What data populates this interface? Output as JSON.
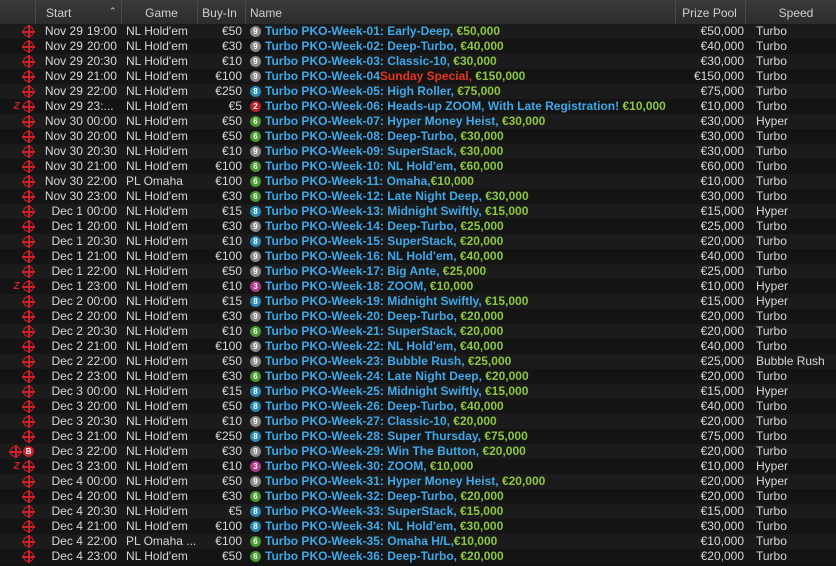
{
  "colors": {
    "badge_9": "#8a8a8a",
    "badge_6": "#4a9a32",
    "badge_8": "#2a8ab8",
    "badge_2": "#c0202a",
    "badge_3": "#b23a8a"
  },
  "icons": {
    "target": "crosshair-target-icon",
    "zoom": "zoom-z-icon",
    "bounty": "bounty-b-icon"
  },
  "columns": {
    "start": "Start",
    "game": "Game",
    "buyin": "Buy-In",
    "name": "Name",
    "prize_pool": "Prize Pool",
    "speed": "Speed"
  },
  "rows": [
    {
      "icons": [
        "target"
      ],
      "date": "Nov 29",
      "time": "19:00",
      "game": "NL Hold'em",
      "buyin": "€50",
      "badge": "9",
      "name": "Turbo PKO-Week-01: Early-Deep,",
      "special": "",
      "gtd": " €50,000",
      "pool": "€50,000",
      "speed": "Turbo"
    },
    {
      "icons": [
        "target"
      ],
      "date": "Nov 29",
      "time": "20:00",
      "game": "NL Hold'em",
      "buyin": "€30",
      "badge": "9",
      "name": "Turbo PKO-Week-02: Deep-Turbo,",
      "special": "",
      "gtd": " €40,000",
      "pool": "€40,000",
      "speed": "Turbo"
    },
    {
      "icons": [
        "target"
      ],
      "date": "Nov 29",
      "time": "20:30",
      "game": "NL Hold'em",
      "buyin": "€10",
      "badge": "9",
      "name": "Turbo PKO-Week-03: Classic-10,",
      "special": "",
      "gtd": " €30,000",
      "pool": "€30,000",
      "speed": "Turbo"
    },
    {
      "icons": [
        "target"
      ],
      "date": "Nov 29",
      "time": "21:00",
      "game": "NL Hold'em",
      "buyin": "€100",
      "badge": "9",
      "name": "Turbo PKO-Week-04 ",
      "special": "Sunday Special,",
      "gtd": " €150,000",
      "pool": "€150,000",
      "speed": "Turbo"
    },
    {
      "icons": [
        "target"
      ],
      "date": "Nov 29",
      "time": "22:00",
      "game": "NL Hold'em",
      "buyin": "€250",
      "badge": "8",
      "name": "Turbo PKO-Week-05: High Roller,",
      "special": "",
      "gtd": " €75,000",
      "pool": "€75,000",
      "speed": "Turbo"
    },
    {
      "icons": [
        "zoom",
        "target"
      ],
      "date": "Nov 29",
      "time": "23:...",
      "game": "NL Hold'em",
      "buyin": "€5",
      "badge": "2",
      "name": "Turbo PKO-Week-06: Heads-up ZOOM, With Late Registration!",
      "special": "",
      "gtd": " €10,000",
      "pool": "€10,000",
      "speed": "Turbo"
    },
    {
      "icons": [
        "target"
      ],
      "date": "Nov 30",
      "time": "00:00",
      "game": "NL Hold'em",
      "buyin": "€50",
      "badge": "6",
      "name": "Turbo PKO-Week-07: Hyper Money Heist,",
      "special": "",
      "gtd": " €30,000",
      "pool": "€30,000",
      "speed": "Hyper"
    },
    {
      "icons": [
        "target"
      ],
      "date": "Nov 30",
      "time": "20:00",
      "game": "NL Hold'em",
      "buyin": "€50",
      "badge": "6",
      "name": "Turbo PKO-Week-08: Deep-Turbo,",
      "special": "",
      "gtd": " €30,000",
      "pool": "€30,000",
      "speed": "Turbo"
    },
    {
      "icons": [
        "target"
      ],
      "date": "Nov 30",
      "time": "20:30",
      "game": "NL Hold'em",
      "buyin": "€10",
      "badge": "9",
      "name": "Turbo PKO-Week-09: SuperStack,",
      "special": "",
      "gtd": " €30,000",
      "pool": "€30,000",
      "speed": "Turbo"
    },
    {
      "icons": [
        "target"
      ],
      "date": "Nov 30",
      "time": "21:00",
      "game": "NL Hold'em",
      "buyin": "€100",
      "badge": "6",
      "name": "Turbo PKO-Week-10: NL Hold'em,",
      "special": "",
      "gtd": " €60,000",
      "pool": "€60,000",
      "speed": "Turbo"
    },
    {
      "icons": [
        "target"
      ],
      "date": "Nov 30",
      "time": "22:00",
      "game": "PL Omaha",
      "buyin": "€100",
      "badge": "6",
      "name": "Turbo PKO-Week-11: Omaha,",
      "special": "",
      "gtd": "€10,000",
      "pool": "€10,000",
      "speed": "Turbo"
    },
    {
      "icons": [
        "target"
      ],
      "date": "Nov 30",
      "time": "23:00",
      "game": "NL Hold'em",
      "buyin": "€30",
      "badge": "6",
      "name": "Turbo PKO-Week-12: Late Night Deep,",
      "special": "",
      "gtd": " €30,000",
      "pool": "€30,000",
      "speed": "Turbo"
    },
    {
      "icons": [
        "target"
      ],
      "date": "Dec 1",
      "time": "00:00",
      "game": "NL Hold'em",
      "buyin": "€15",
      "badge": "8",
      "name": "Turbo PKO-Week-13: Midnight Swiftly,",
      "special": "",
      "gtd": " €15,000",
      "pool": "€15,000",
      "speed": "Hyper"
    },
    {
      "icons": [
        "target"
      ],
      "date": "Dec 1",
      "time": "20:00",
      "game": "NL Hold'em",
      "buyin": "€30",
      "badge": "9",
      "name": "Turbo PKO-Week-14: Deep-Turbo,",
      "special": "",
      "gtd": " €25,000",
      "pool": "€25,000",
      "speed": "Turbo"
    },
    {
      "icons": [
        "target"
      ],
      "date": "Dec 1",
      "time": "20:30",
      "game": "NL Hold'em",
      "buyin": "€10",
      "badge": "8",
      "name": "Turbo PKO-Week-15: SuperStack,",
      "special": "",
      "gtd": " €20,000",
      "pool": "€20,000",
      "speed": "Turbo"
    },
    {
      "icons": [
        "target"
      ],
      "date": "Dec 1",
      "time": "21:00",
      "game": "NL Hold'em",
      "buyin": "€100",
      "badge": "9",
      "name": "Turbo PKO-Week-16: NL Hold'em,",
      "special": "",
      "gtd": " €40,000",
      "pool": "€40,000",
      "speed": "Turbo"
    },
    {
      "icons": [
        "target"
      ],
      "date": "Dec 1",
      "time": "22:00",
      "game": "NL Hold'em",
      "buyin": "€50",
      "badge": "9",
      "name": "Turbo PKO-Week-17: Big Ante,",
      "special": "",
      "gtd": " €25,000",
      "pool": "€25,000",
      "speed": "Turbo"
    },
    {
      "icons": [
        "zoom",
        "target"
      ],
      "date": "Dec 1",
      "time": "23:00",
      "game": "NL Hold'em",
      "buyin": "€10",
      "badge": "3",
      "name": "Turbo PKO-Week-18: ZOOM,",
      "special": "",
      "gtd": " €10,000",
      "pool": "€10,000",
      "speed": "Hyper"
    },
    {
      "icons": [
        "target"
      ],
      "date": "Dec 2",
      "time": "00:00",
      "game": "NL Hold'em",
      "buyin": "€15",
      "badge": "8",
      "name": "Turbo PKO-Week-19: Midnight Swiftly,",
      "special": "",
      "gtd": " €15,000",
      "pool": "€15,000",
      "speed": "Hyper"
    },
    {
      "icons": [
        "target"
      ],
      "date": "Dec 2",
      "time": "20:00",
      "game": "NL Hold'em",
      "buyin": "€30",
      "badge": "9",
      "name": "Turbo PKO-Week-20: Deep-Turbo,",
      "special": "",
      "gtd": " €20,000",
      "pool": "€20,000",
      "speed": "Turbo"
    },
    {
      "icons": [
        "target"
      ],
      "date": "Dec 2",
      "time": "20:30",
      "game": "NL Hold'em",
      "buyin": "€10",
      "badge": "6",
      "name": "Turbo PKO-Week-21: SuperStack,",
      "special": "",
      "gtd": " €20,000",
      "pool": "€20,000",
      "speed": "Turbo"
    },
    {
      "icons": [
        "target"
      ],
      "date": "Dec 2",
      "time": "21:00",
      "game": "NL Hold'em",
      "buyin": "€100",
      "badge": "9",
      "name": "Turbo PKO-Week-22: NL Hold'em,",
      "special": "",
      "gtd": " €40,000",
      "pool": "€40,000",
      "speed": "Turbo"
    },
    {
      "icons": [
        "target"
      ],
      "date": "Dec 2",
      "time": "22:00",
      "game": "NL Hold'em",
      "buyin": "€50",
      "badge": "9",
      "name": "Turbo PKO-Week-23: Bubble Rush,",
      "special": "",
      "gtd": " €25,000",
      "pool": "€25,000",
      "speed": "Bubble Rush"
    },
    {
      "icons": [
        "target"
      ],
      "date": "Dec 2",
      "time": "23:00",
      "game": "NL Hold'em",
      "buyin": "€30",
      "badge": "6",
      "name": "Turbo PKO-Week-24: Late Night Deep,",
      "special": "",
      "gtd": " €20,000",
      "pool": "€20,000",
      "speed": "Turbo"
    },
    {
      "icons": [
        "target"
      ],
      "date": "Dec 3",
      "time": "00:00",
      "game": "NL Hold'em",
      "buyin": "€15",
      "badge": "8",
      "name": "Turbo PKO-Week-25: Midnight Swiftly,",
      "special": "",
      "gtd": " €15,000",
      "pool": "€15,000",
      "speed": "Hyper"
    },
    {
      "icons": [
        "target"
      ],
      "date": "Dec 3",
      "time": "20:00",
      "game": "NL Hold'em",
      "buyin": "€50",
      "badge": "8",
      "name": "Turbo PKO-Week-26: Deep-Turbo,",
      "special": "",
      "gtd": " €40,000",
      "pool": "€40,000",
      "speed": "Turbo"
    },
    {
      "icons": [
        "target"
      ],
      "date": "Dec 3",
      "time": "20:30",
      "game": "NL Hold'em",
      "buyin": "€10",
      "badge": "9",
      "name": "Turbo PKO-Week-27: Classic-10,",
      "special": "",
      "gtd": " €20,000",
      "pool": "€20,000",
      "speed": "Turbo"
    },
    {
      "icons": [
        "target"
      ],
      "date": "Dec 3",
      "time": "21:00",
      "game": "NL Hold'em",
      "buyin": "€250",
      "badge": "8",
      "name": "Turbo PKO-Week-28: Super Thursday,",
      "special": "",
      "gtd": " €75,000",
      "pool": "€75,000",
      "speed": "Turbo"
    },
    {
      "icons": [
        "target",
        "bounty"
      ],
      "date": "Dec 3",
      "time": "22:00",
      "game": "NL Hold'em",
      "buyin": "€30",
      "badge": "9",
      "name": "Turbo PKO-Week-29: Win The Button,",
      "special": "",
      "gtd": " €20,000",
      "pool": "€20,000",
      "speed": "Turbo"
    },
    {
      "icons": [
        "zoom",
        "target"
      ],
      "date": "Dec 3",
      "time": "23:00",
      "game": "NL Hold'em",
      "buyin": "€10",
      "badge": "3",
      "name": "Turbo PKO-Week-30: ZOOM,",
      "special": "",
      "gtd": " €10,000",
      "pool": "€10,000",
      "speed": "Hyper"
    },
    {
      "icons": [
        "target"
      ],
      "date": "Dec 4",
      "time": "00:00",
      "game": "NL Hold'em",
      "buyin": "€50",
      "badge": "9",
      "name": "Turbo PKO-Week-31: Hyper Money Heist,",
      "special": "",
      "gtd": " €20,000",
      "pool": "€20,000",
      "speed": "Hyper"
    },
    {
      "icons": [
        "target"
      ],
      "date": "Dec 4",
      "time": "20:00",
      "game": "NL Hold'em",
      "buyin": "€30",
      "badge": "6",
      "name": "Turbo PKO-Week-32: Deep-Turbo,",
      "special": "",
      "gtd": " €20,000",
      "pool": "€20,000",
      "speed": "Turbo"
    },
    {
      "icons": [
        "target"
      ],
      "date": "Dec 4",
      "time": "20:30",
      "game": "NL Hold'em",
      "buyin": "€5",
      "badge": "8",
      "name": "Turbo PKO-Week-33: SuperStack,",
      "special": "",
      "gtd": " €15,000",
      "pool": "€15,000",
      "speed": "Turbo"
    },
    {
      "icons": [
        "target"
      ],
      "date": "Dec 4",
      "time": "21:00",
      "game": "NL Hold'em",
      "buyin": "€100",
      "badge": "8",
      "name": "Turbo PKO-Week-34: NL Hold'em,",
      "special": "",
      "gtd": " €30,000",
      "pool": "€30,000",
      "speed": "Turbo"
    },
    {
      "icons": [
        "target"
      ],
      "date": "Dec 4",
      "time": "22:00",
      "game": "PL Omaha ...",
      "buyin": "€100",
      "badge": "6",
      "name": "Turbo PKO-Week-35: Omaha H/L,",
      "special": "",
      "gtd": "€10,000",
      "pool": "€10,000",
      "speed": "Turbo"
    },
    {
      "icons": [
        "target"
      ],
      "date": "Dec 4",
      "time": "23:00",
      "game": "NL Hold'em",
      "buyin": "€50",
      "badge": "6",
      "name": "Turbo PKO-Week-36: Deep-Turbo,",
      "special": "",
      "gtd": " €20,000",
      "pool": "€20,000",
      "speed": "Turbo"
    }
  ]
}
